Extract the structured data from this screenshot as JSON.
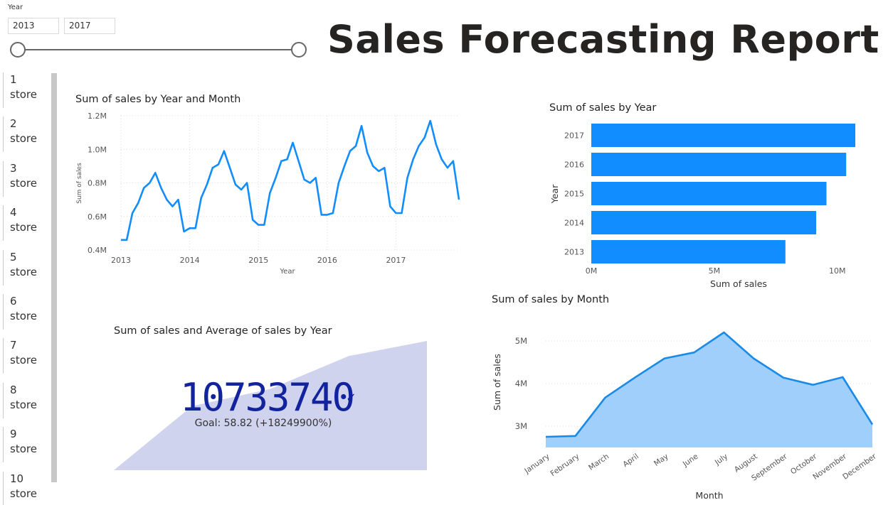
{
  "slicer": {
    "label": "Year",
    "start_value": "2013",
    "end_value": "2017",
    "range_min": 2013,
    "range_max": 2017,
    "selected_start": 2013,
    "selected_end": 2017
  },
  "report_title": "Sales Forecasting Report",
  "stores": [
    {
      "number": "1",
      "label": "store"
    },
    {
      "number": "2",
      "label": "store"
    },
    {
      "number": "3",
      "label": "store"
    },
    {
      "number": "4",
      "label": "store"
    },
    {
      "number": "5",
      "label": "store"
    },
    {
      "number": "6",
      "label": "store"
    },
    {
      "number": "7",
      "label": "store"
    },
    {
      "number": "8",
      "label": "store"
    },
    {
      "number": "9",
      "label": "store"
    },
    {
      "number": "10",
      "label": "store"
    }
  ],
  "colors": {
    "line": "#118dff",
    "bar": "#118dff",
    "area_fill": "#a0cffc",
    "area_line": "#1a8ae8",
    "kpi_area": "#d0d3ee",
    "kpi_text": "#12239e"
  },
  "kpi": {
    "title": "Sum of sales and Average of sales by Year",
    "value": "10733740",
    "goal_text": "Goal: 58.82 (+18249900%)",
    "check_icon": "✓"
  },
  "chart_data": [
    {
      "type": "line",
      "title": "Sum of sales by Year and Month",
      "xlabel": "Year",
      "ylabel": "Sum of sales",
      "x_ticks": [
        "2013",
        "2014",
        "2015",
        "2016",
        "2017"
      ],
      "y_ticks": [
        "0.4M",
        "0.6M",
        "0.8M",
        "1.0M",
        "1.2M"
      ],
      "ylim": [
        0.4,
        1.2
      ],
      "y_units": "M",
      "grid": true,
      "series": [
        {
          "values": [
            0.46,
            0.46,
            0.62,
            0.68,
            0.77,
            0.8,
            0.86,
            0.77,
            0.7,
            0.66,
            0.7,
            0.51,
            0.53,
            0.53,
            0.71,
            0.79,
            0.89,
            0.91,
            0.99,
            0.89,
            0.79,
            0.76,
            0.8,
            0.58,
            0.55,
            0.55,
            0.74,
            0.83,
            0.93,
            0.94,
            1.04,
            0.93,
            0.82,
            0.8,
            0.83,
            0.61,
            0.61,
            0.62,
            0.8,
            0.9,
            0.99,
            1.02,
            1.14,
            0.98,
            0.9,
            0.87,
            0.89,
            0.66,
            0.62,
            0.62,
            0.83,
            0.94,
            1.02,
            1.07,
            1.17,
            1.03,
            0.94,
            0.89,
            0.93,
            0.7
          ]
        }
      ]
    },
    {
      "type": "bar",
      "orientation": "horizontal",
      "title": "Sum of sales by Year",
      "xlabel": "Sum of sales",
      "ylabel": "Year",
      "categories": [
        "2017",
        "2016",
        "2015",
        "2014",
        "2013"
      ],
      "values": [
        10.73,
        10.36,
        9.56,
        9.14,
        7.89
      ],
      "x_ticks": [
        "0M",
        "5M",
        "10M"
      ],
      "xlim": [
        0,
        10.73
      ],
      "x_units": "M"
    },
    {
      "type": "area",
      "title": "Sum of sales by Month",
      "xlabel": "Month",
      "ylabel": "Sum of sales",
      "categories": [
        "January",
        "February",
        "March",
        "April",
        "May",
        "June",
        "July",
        "August",
        "September",
        "October",
        "November",
        "December"
      ],
      "values": [
        2.75,
        2.77,
        3.67,
        4.14,
        4.59,
        4.73,
        5.2,
        4.59,
        4.14,
        3.97,
        4.15,
        3.04
      ],
      "y_ticks": [
        "3M",
        "4M",
        "5M"
      ],
      "ylim": [
        2.5,
        5.5
      ],
      "y_units": "M"
    },
    {
      "type": "area",
      "title": "Sum of sales and Average of sales by Year",
      "categories": [
        "2013",
        "2014",
        "2015",
        "2016",
        "2017"
      ],
      "values": [
        7.89,
        9.14,
        9.56,
        10.36,
        10.73
      ]
    }
  ]
}
